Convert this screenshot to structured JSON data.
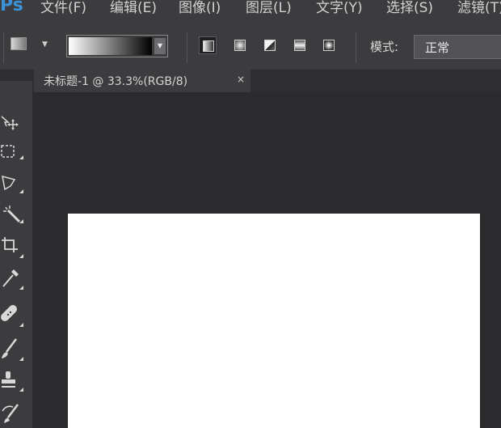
{
  "app": {
    "logo": "Ps",
    "menu": [
      "文件(F)",
      "编辑(E)",
      "图像(I)",
      "图层(L)",
      "文字(Y)",
      "选择(S)",
      "滤镜(T)"
    ]
  },
  "options": {
    "gradient_types": [
      "linear",
      "radial",
      "angle",
      "reflected",
      "diamond"
    ],
    "mode_label": "模式:",
    "mode_value": "正常"
  },
  "document": {
    "tab_title": "未标题-1 @ 33.3%(RGB/8)",
    "close_glyph": "×"
  },
  "tools": [
    "move",
    "marquee",
    "lasso",
    "magic-wand",
    "crop",
    "eyedropper",
    "healing-brush",
    "brush",
    "clone-stamp",
    "history-brush"
  ]
}
